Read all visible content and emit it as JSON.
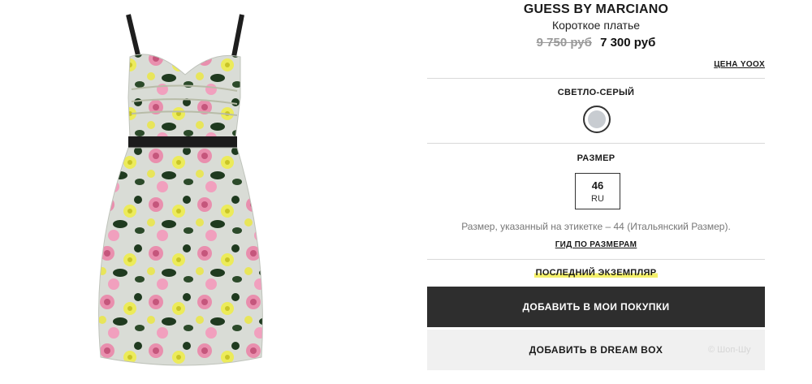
{
  "product": {
    "brand": "GUESS BY MARCIANO",
    "name": "Короткое платье",
    "old_price": "9 750 руб",
    "new_price": "7 300 руб",
    "price_link": "ЦЕНА YOOX"
  },
  "color": {
    "label": "СВЕТЛО-СЕРЫЙ",
    "swatch_hex": "#c8ccd1"
  },
  "size": {
    "heading": "РАЗМЕР",
    "value": "46",
    "system": "RU",
    "note": "Размер, указанный на этикетке – 44 (Итальянский Размер).",
    "guide_link": "ГИД ПО РАЗМЕРАМ"
  },
  "stock": {
    "label": "ПОСЛЕДНИЙ ЭКЗЕМПЛЯР"
  },
  "actions": {
    "add_to_cart": "ДОБАВИТЬ В МОИ ПОКУПКИ",
    "add_to_dreambox": "ДОБАВИТЬ В DREAM BOX"
  },
  "watermark": "© Шоп-Шу",
  "colors": {
    "button_dark": "#2e2e2e",
    "button_light": "#f0f0f0",
    "highlight": "#f4f06a"
  }
}
